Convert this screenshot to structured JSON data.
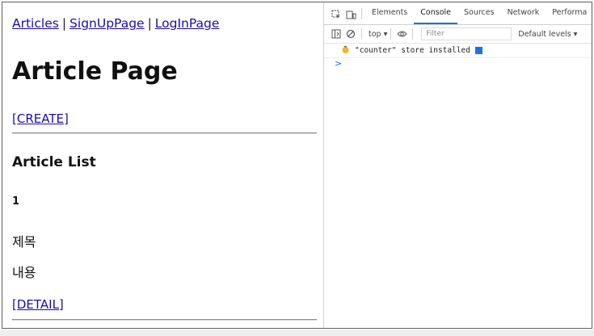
{
  "nav": {
    "articles": "Articles",
    "signup": "SignUpPage",
    "login": "LogInPage",
    "separator": "|"
  },
  "page": {
    "heading": "Article Page",
    "create_link": "[CREATE]",
    "list_heading": "Article List",
    "article": {
      "id": "1",
      "title": "제목",
      "content": "내용",
      "detail_link": "[DETAIL]"
    }
  },
  "devtools": {
    "tabs": [
      "Elements",
      "Console",
      "Sources",
      "Network",
      "Performa"
    ],
    "active_tab": "Console",
    "context": "top",
    "filter_placeholder": "Filter",
    "levels": "Default levels",
    "log_message": "\"counter\" store installed",
    "prompt": ">"
  },
  "colors": {
    "link": "#1a0dab",
    "devtools_accent": "#1a73e8"
  }
}
